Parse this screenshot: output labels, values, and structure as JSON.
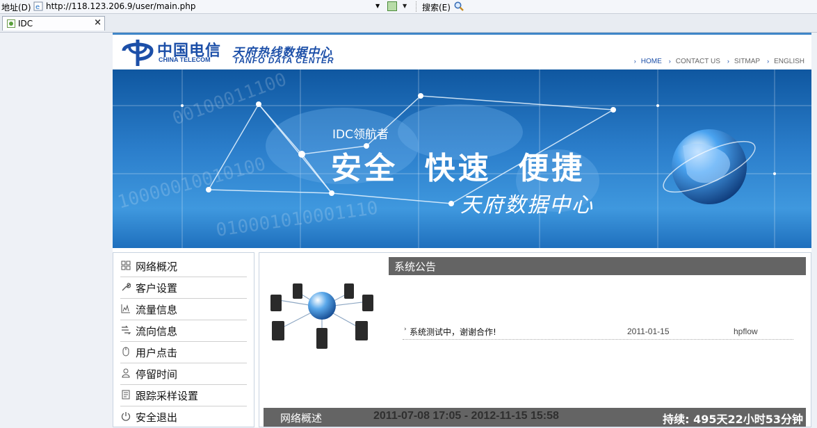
{
  "browser": {
    "address_label": "地址(D)",
    "url": "http://118.123.206.9/user/main.php",
    "search_label": "搜索(E)",
    "tab_title": "IDC",
    "tab_close": "×"
  },
  "header": {
    "logo_cn": "中国电信",
    "logo_en": "CHINA TELECOM",
    "center_cn": "天府热线数据中心",
    "center_en": "TANFO DATA CENTER",
    "nav": [
      {
        "label": "HOME"
      },
      {
        "label": "CONTACT US"
      },
      {
        "label": "SITMAP"
      },
      {
        "label": "ENGLISH"
      }
    ],
    "brand_color": "#1c4fa8"
  },
  "banner": {
    "tagline": "IDC领航者",
    "main": "安全  快速  便捷",
    "sub": "天府数据中心"
  },
  "sidebar": {
    "items": [
      {
        "label": "网络概况",
        "icon": "grid-icon"
      },
      {
        "label": "客户设置",
        "icon": "wrench-icon"
      },
      {
        "label": "流量信息",
        "icon": "chart-icon"
      },
      {
        "label": "流向信息",
        "icon": "flow-icon"
      },
      {
        "label": "用户点击",
        "icon": "mouse-icon"
      },
      {
        "label": "停留时间",
        "icon": "person-icon"
      },
      {
        "label": "跟踪采样设置",
        "icon": "document-icon"
      },
      {
        "label": "安全退出",
        "icon": "power-icon"
      }
    ]
  },
  "notice": {
    "title": "系统公告",
    "rows": [
      {
        "text": "系统测试中，谢谢合作!",
        "date": "2011-01-15",
        "author": "hpflow"
      }
    ]
  },
  "overview": {
    "label": "网络概述",
    "range": "2011-07-08 17:05 - 2012-11-15 15:58",
    "duration": "持续: 495天22小时53分钟"
  }
}
